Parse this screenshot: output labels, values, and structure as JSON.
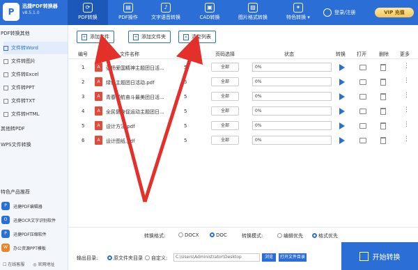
{
  "app": {
    "logo_glyph": "P",
    "name": "迅捷PDF转换器",
    "version": "v8.5.1.0"
  },
  "nav": [
    {
      "label": "PDF转换",
      "glyph": "⟳"
    },
    {
      "label": "PDF操作",
      "glyph": "▤"
    },
    {
      "label": "文字语音转换",
      "glyph": "♪"
    },
    {
      "label": "CAD转换",
      "glyph": "▣"
    },
    {
      "label": "图片格式转换",
      "glyph": "▨"
    },
    {
      "label": "特色转换 ▾",
      "glyph": "✦"
    }
  ],
  "header": {
    "login_label": "登录/注册",
    "vip_label": "VIP 充值"
  },
  "sidebar": {
    "section1": "PDF转换其他",
    "items": [
      "文件转Word",
      "文件转图片",
      "文件转Excel",
      "文件转PPT",
      "文件转TXT",
      "文件转HTML"
    ],
    "section2": "其他转PDF",
    "section3": "WPS文件转换",
    "promo_title": "特色产品推荐",
    "promos": [
      {
        "icon": "P",
        "label": "迅捷PDF编辑器"
      },
      {
        "icon": "O",
        "label": "迅捷OCR文字识别软件"
      },
      {
        "icon": "P",
        "label": "迅捷PDF压缩软件"
      },
      {
        "icon": "W",
        "label": "办公资源PPT模板"
      }
    ],
    "bottom_left": "☐ 在线客服",
    "bottom_right": "◎ 官网地址"
  },
  "toolbar": {
    "add_file": "添加文件",
    "add_folder": "添加文件夹",
    "clear_list": "清空列表"
  },
  "table": {
    "headers": {
      "index": "编号",
      "name": "文件名称",
      "pages": "页数",
      "page_select": "页码选择",
      "status": "状态",
      "convert": "转换",
      "open": "打开",
      "delete": "删除",
      "more": "更多"
    },
    "rows": [
      {
        "index": "1",
        "name": "弘扬爱国精神主题团日活...",
        "pages": "5",
        "select": "全部",
        "status": "0%"
      },
      {
        "index": "2",
        "name": "绿色主题团日活动.pdf",
        "pages": "5",
        "select": "全部",
        "status": "0%"
      },
      {
        "index": "3",
        "name": "青春领航奋斗最美团日活...",
        "pages": "5",
        "select": "全部",
        "status": "0%"
      },
      {
        "index": "4",
        "name": "全民健身促运动主题团日...",
        "pages": "5",
        "select": "全部",
        "status": "0%"
      },
      {
        "index": "5",
        "name": "设计方法.pdf",
        "pages": "5",
        "select": "全部",
        "status": "0%"
      },
      {
        "index": "6",
        "name": "设计图纸.pdf",
        "pages": "5",
        "select": "全部",
        "status": "0%"
      }
    ]
  },
  "footer": {
    "format_label": "转换格式:",
    "format_docx": "DOCX",
    "format_doc": "DOC",
    "mode_label": "转换模式:",
    "mode_edit": "编辑优先",
    "mode_format": "格式优先",
    "output_label": "输出目录:",
    "output_source": "原文件夹目录",
    "output_custom": "自定义:",
    "path": "C:\\Users\\Administrator\\Desktop",
    "browse": "浏览",
    "open_dir": "打开文件目录",
    "start": "开始转换"
  },
  "colors": {
    "primary": "#2b6fd6",
    "annotation": "#e3302b",
    "pdf": "#e24a3b"
  }
}
